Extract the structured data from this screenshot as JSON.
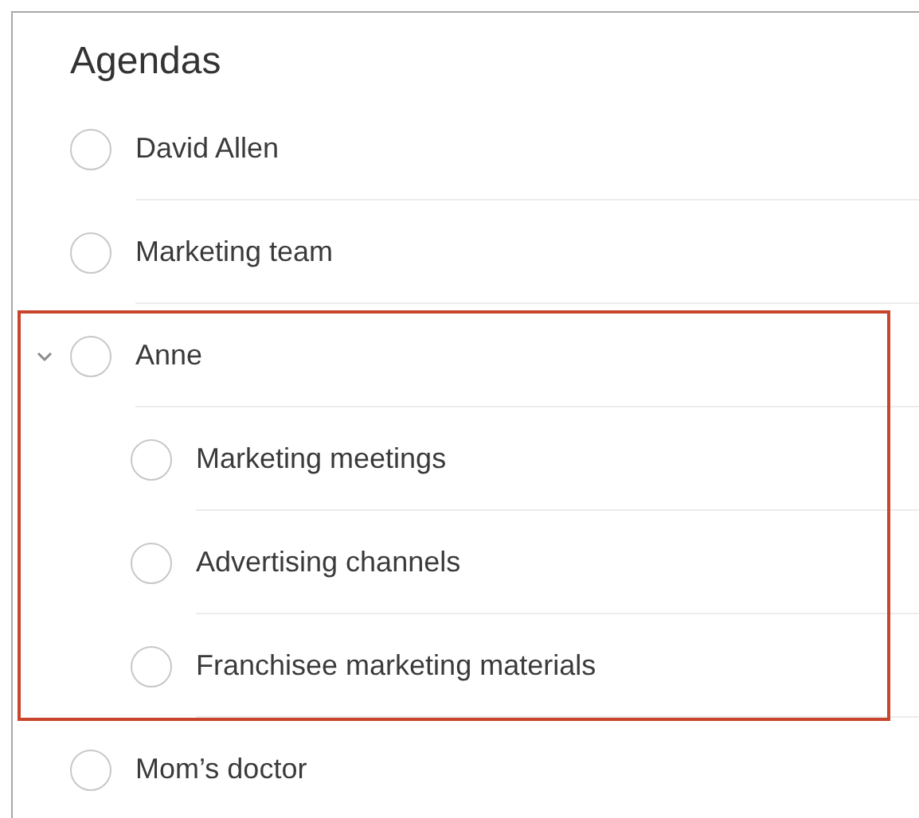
{
  "title": "Agendas",
  "items": [
    {
      "label": "David Allen",
      "checked": false
    },
    {
      "label": "Marketing team",
      "checked": false
    },
    {
      "label": "Anne",
      "checked": false,
      "expanded": true,
      "highlighted": true,
      "children": [
        {
          "label": "Marketing meetings",
          "checked": false
        },
        {
          "label": "Advertising channels",
          "checked": false
        },
        {
          "label": "Franchisee marketing materials",
          "checked": false
        }
      ]
    },
    {
      "label": "Mom’s doctor",
      "checked": false
    }
  ]
}
